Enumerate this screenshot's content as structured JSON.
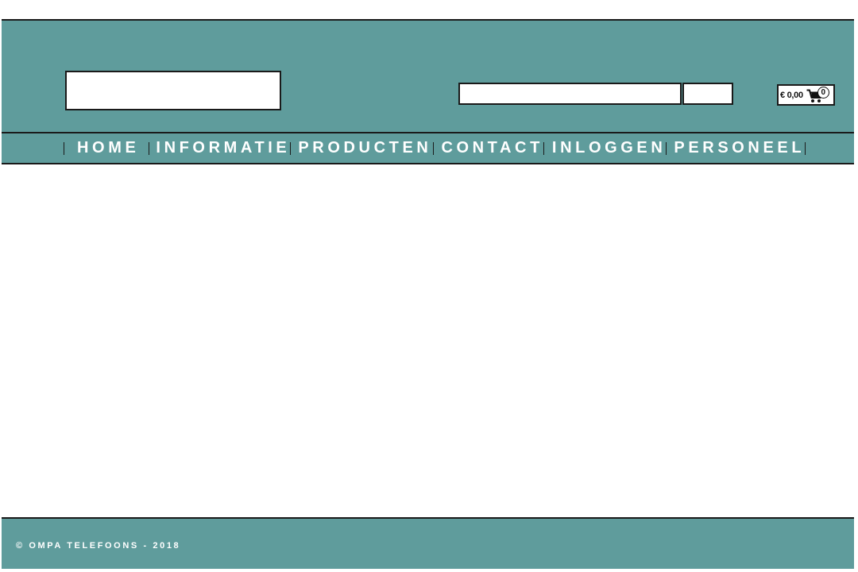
{
  "colors": {
    "header_bg": "#5f9c9c",
    "border": "#1a1a1a",
    "nav_text": "#ffffff",
    "page_bg": "#ffffff"
  },
  "header": {
    "logo_text": "",
    "search": {
      "value": "",
      "placeholder": "",
      "button_label": ""
    },
    "cart": {
      "amount": "€ 0,00",
      "count": "0",
      "icon": "shopping-cart-icon"
    }
  },
  "nav": {
    "items": [
      {
        "label": "HOME"
      },
      {
        "label": "INFORMATIE"
      },
      {
        "label": "PRODUCTEN"
      },
      {
        "label": "CONTACT"
      },
      {
        "label": "INLOGGEN"
      },
      {
        "label": "PERSONEEL"
      }
    ]
  },
  "main": {
    "content": ""
  },
  "footer": {
    "copyright": "© OMPA TELEFOONS - 2018"
  }
}
